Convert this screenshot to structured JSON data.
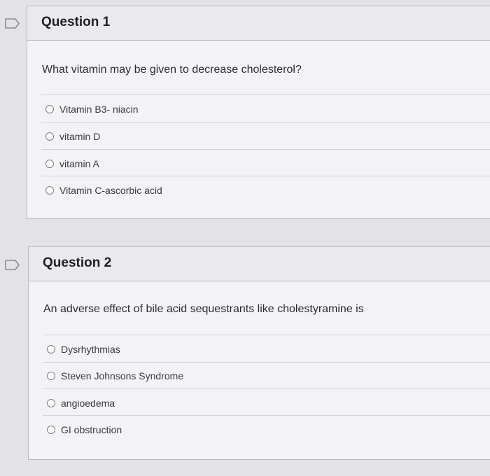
{
  "questions": [
    {
      "title": "Question 1",
      "text": "What vitamin may be given to decrease cholesterol?",
      "options": [
        "Vitamin B3- niacin",
        "vitamin D",
        "vitamin A",
        "Vitamin C-ascorbic acid"
      ]
    },
    {
      "title": "Question 2",
      "text": "An adverse effect of bile acid sequestrants like cholestyramine is",
      "options": [
        "Dysrhythmias",
        "Steven Johnsons Syndrome",
        "angioedema",
        "GI obstruction"
      ]
    }
  ],
  "colors": {
    "background": "#e3e3e5",
    "card": "#f3f3f5",
    "flag_outline": "#8a8a90"
  },
  "icons": {
    "flag": "flag-icon",
    "radio": "radio-button"
  }
}
